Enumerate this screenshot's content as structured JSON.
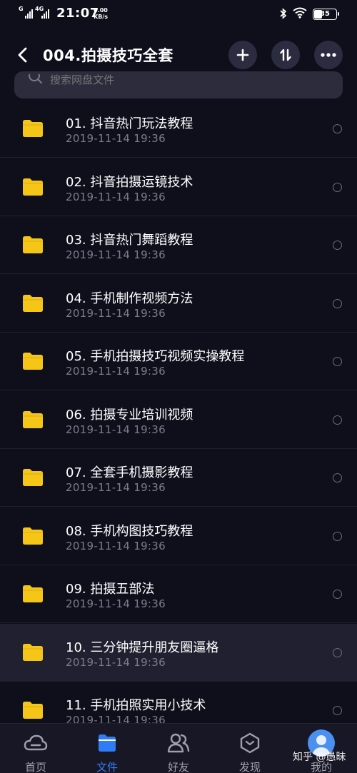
{
  "status_bar": {
    "signal_1": "G",
    "signal_2": "4G",
    "time": "21:07",
    "speed_value": "0.00",
    "speed_unit": "KB/s",
    "battery": "35"
  },
  "header": {
    "title": "004.拍摄技巧全套"
  },
  "search": {
    "placeholder": "搜索网盘文件"
  },
  "files": [
    {
      "name": "01. 抖音热门玩法教程",
      "date": "2019-11-14  19:36"
    },
    {
      "name": "02. 抖音拍摄运镜技术",
      "date": "2019-11-14  19:36"
    },
    {
      "name": "03. 抖音热门舞蹈教程",
      "date": "2019-11-14  19:36"
    },
    {
      "name": "04. 手机制作视频方法",
      "date": "2019-11-14  19:36"
    },
    {
      "name": "05. 手机拍摄技巧视频实操教程",
      "date": "2019-11-14  19:36"
    },
    {
      "name": "06. 拍摄专业培训视频",
      "date": "2019-11-14  19:36"
    },
    {
      "name": "07. 全套手机摄影教程",
      "date": "2019-11-14  19:36"
    },
    {
      "name": "08. 手机构图技巧教程",
      "date": "2019-11-14  19:36"
    },
    {
      "name": "09. 拍摄五部法",
      "date": "2019-11-14  19:36"
    },
    {
      "name": "10. 三分钟提升朋友圈逼格",
      "date": "2019-11-14  19:36"
    },
    {
      "name": "11. 手机拍照实用小技术",
      "date": "2019-11-14  19:36"
    }
  ],
  "tabs": [
    {
      "label": "首页",
      "icon": "home-cloud-icon"
    },
    {
      "label": "文件",
      "icon": "file-folder-icon"
    },
    {
      "label": "好友",
      "icon": "friends-icon"
    },
    {
      "label": "发现",
      "icon": "discover-icon"
    },
    {
      "label": "我的",
      "icon": "avatar"
    }
  ],
  "watermark": "知乎 @愚昧",
  "colors": {
    "background": "#0f0f1c",
    "accent": "#2f7cf6",
    "folder": "#f5c518",
    "text_secondary": "#7c7c8a"
  }
}
